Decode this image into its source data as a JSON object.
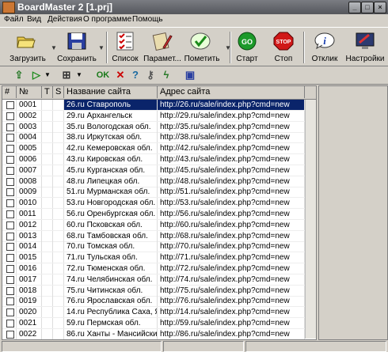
{
  "window": {
    "title": "BoardMaster 2  [1.prj]"
  },
  "menu": [
    "Файл",
    "Вид",
    "Действия",
    "О программе",
    "Помощь"
  ],
  "toolbar": {
    "load": "Загрузить",
    "save": "Сохранить",
    "list": "Список",
    "params": "Парамет...",
    "mark": "Пометить",
    "start": "Старт",
    "stop": "Стоп",
    "response": "Отклик",
    "settings": "Настройки",
    "start_icon_text": "GO",
    "stop_icon_text": "STOP"
  },
  "toolbar2": {
    "ok": "OK"
  },
  "table": {
    "headers": [
      "#",
      "№",
      "T",
      "S",
      "Название сайта",
      "Адрес сайта"
    ],
    "rows": [
      {
        "num": "0001",
        "name": "26.ru Ставрополь",
        "url": "http://26.ru/sale/index.php?cmd=new"
      },
      {
        "num": "0002",
        "name": "29.ru Архангельск",
        "url": "http://29.ru/sale/index.php?cmd=new"
      },
      {
        "num": "0003",
        "name": "35.ru Вологодская обл.",
        "url": "http://35.ru/sale/index.php?cmd=new"
      },
      {
        "num": "0004",
        "name": "38.ru Иркутская обл.",
        "url": "http://38.ru/sale/index.php?cmd=new"
      },
      {
        "num": "0005",
        "name": "42.ru Кемеровская обл.",
        "url": "http://42.ru/sale/index.php?cmd=new"
      },
      {
        "num": "0006",
        "name": "43.ru Кировская обл.",
        "url": "http://43.ru/sale/index.php?cmd=new"
      },
      {
        "num": "0007",
        "name": "45.ru Курганская обл.",
        "url": "http://45.ru/sale/index.php?cmd=new"
      },
      {
        "num": "0008",
        "name": "48.ru Липецкая обл.",
        "url": "http://48.ru/sale/index.php?cmd=new"
      },
      {
        "num": "0009",
        "name": "51.ru Мурманская обл.",
        "url": "http://51.ru/sale/index.php?cmd=new"
      },
      {
        "num": "0010",
        "name": "53.ru Новгородская обл.",
        "url": "http://53.ru/sale/index.php?cmd=new"
      },
      {
        "num": "0011",
        "name": "56.ru Оренбургская обл.",
        "url": "http://56.ru/sale/index.php?cmd=new"
      },
      {
        "num": "0012",
        "name": "60.ru Псковская обл.",
        "url": "http://60.ru/sale/index.php?cmd=new"
      },
      {
        "num": "0013",
        "name": "68.ru Тамбовская обл.",
        "url": "http://68.ru/sale/index.php?cmd=new"
      },
      {
        "num": "0014",
        "name": "70.ru Томская обл.",
        "url": "http://70.ru/sale/index.php?cmd=new"
      },
      {
        "num": "0015",
        "name": "71.ru Тульская обл.",
        "url": "http://71.ru/sale/index.php?cmd=new"
      },
      {
        "num": "0016",
        "name": "72.ru Тюменская обл.",
        "url": "http://72.ru/sale/index.php?cmd=new"
      },
      {
        "num": "0017",
        "name": "74.ru Челябинская обл.",
        "url": "http://74.ru/sale/index.php?cmd=new"
      },
      {
        "num": "0018",
        "name": "75.ru Читинская обл.",
        "url": "http://75.ru/sale/index.php?cmd=new"
      },
      {
        "num": "0019",
        "name": "76.ru Ярославская обл.",
        "url": "http://76.ru/sale/index.php?cmd=new"
      },
      {
        "num": "0020",
        "name": "14.ru Республика Саха, Як...",
        "url": "http://14.ru/sale/index.php?cmd=new"
      },
      {
        "num": "0021",
        "name": "59.ru Пермская обл.",
        "url": "http://59.ru/sale/index.php?cmd=new"
      },
      {
        "num": "0022",
        "name": "86.ru Ханты - Мансийский...",
        "url": "http://86.ru/sale/index.php?cmd=new"
      }
    ]
  }
}
